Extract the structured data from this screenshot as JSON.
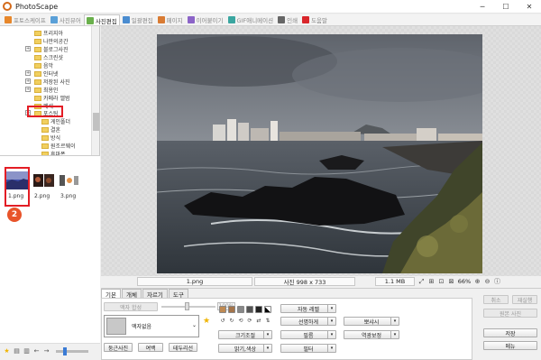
{
  "window": {
    "title": "PhotoScape",
    "minimize": "─",
    "maximize": "☐",
    "close": "✕"
  },
  "tabs": [
    {
      "label": "포토스케이프",
      "color": "#e7872b"
    },
    {
      "label": "사진뷰어",
      "color": "#5aa0d8"
    },
    {
      "label": "사진편집",
      "color": "#6ab04c",
      "active": true
    },
    {
      "label": "일괄편집",
      "color": "#4a8cd0"
    },
    {
      "label": "페이지",
      "color": "#d97b33"
    },
    {
      "label": "이어붙이기",
      "color": "#8c64c8"
    },
    {
      "label": "GIF애니메이션",
      "color": "#3aa6a0"
    },
    {
      "label": "인쇄",
      "color": "#666666"
    },
    {
      "label": "도움말",
      "color": "#d9262b"
    }
  ],
  "tree": {
    "items": [
      {
        "label": "프리지아",
        "indent": 1
      },
      {
        "label": "나만의공간",
        "indent": 1
      },
      {
        "label": "블로그사진",
        "indent": 1,
        "exp": "+"
      },
      {
        "label": "스크린샷",
        "indent": 1
      },
      {
        "label": "음악",
        "indent": 1
      },
      {
        "label": "인터넷",
        "indent": 1,
        "exp": "+"
      },
      {
        "label": "저장된 사진",
        "indent": 1,
        "exp": "+"
      },
      {
        "label": "최용인",
        "indent": 1,
        "exp": "+"
      },
      {
        "label": "카메라 앨범",
        "indent": 1
      },
      {
        "label": "폐쇄",
        "indent": 1
      },
      {
        "label": "포스팅",
        "indent": 1,
        "exp": "−",
        "selected": true
      },
      {
        "label": "게인폴더",
        "indent": 2
      },
      {
        "label": "결혼",
        "indent": 2
      },
      {
        "label": "방식",
        "indent": 2
      },
      {
        "label": "원조르웨이",
        "indent": 2
      },
      {
        "label": "휴마폰",
        "indent": 2
      },
      {
        "label": "상송",
        "indent": 2
      }
    ]
  },
  "thumbnails": [
    {
      "label": "1.png"
    },
    {
      "label": "2.png"
    },
    {
      "label": "3.png"
    }
  ],
  "badge": "2",
  "status": {
    "filename": "1.png",
    "dimensions": "사진 998 x 733",
    "filesize": "1.1 MB",
    "zoom": "66%"
  },
  "bottom": {
    "subtabs": [
      "기본",
      "개체",
      "자르기",
      "도구"
    ],
    "effect_label": "액자 합성",
    "percent": "100%",
    "preset": "액자없음",
    "buttons": {
      "round_photo": "둥근사진",
      "margin": "여백",
      "frame_line": "테두리선",
      "auto_level": "자동 레벨",
      "sharpen": "선명하게",
      "resize": "크기조절",
      "brightness": "밝기,색상",
      "film": "필름",
      "bloom": "뽀샤시",
      "backlight": "역광보정",
      "filter": "필터"
    },
    "right": {
      "undo": "취소",
      "redo": "재실행",
      "undo_all": "원본 사진",
      "save": "저장",
      "menu": "메뉴"
    }
  }
}
